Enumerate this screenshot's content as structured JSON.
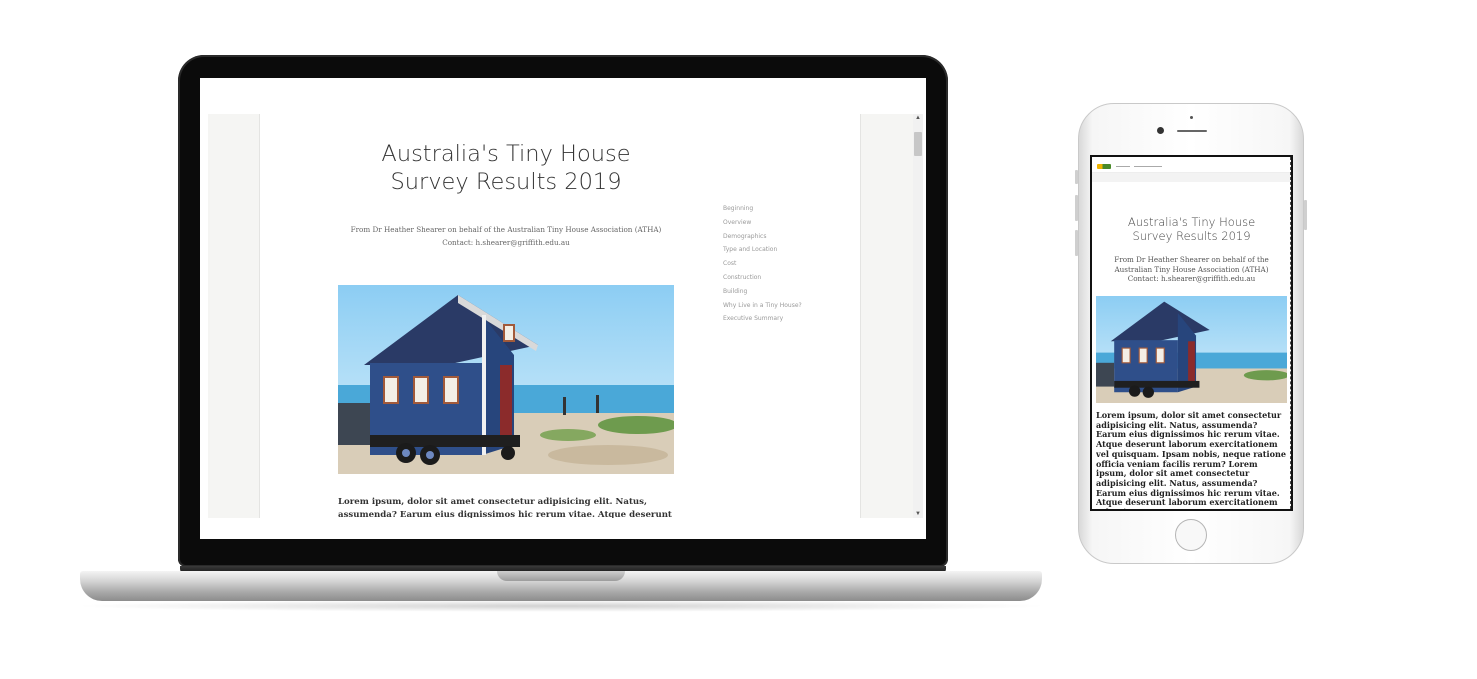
{
  "laptop_page": {
    "title": "Australia's Tiny House Survey Results 2019",
    "byline_line1": "From Dr Heather Shearer on behalf of the Australian Tiny House Association (ATHA)",
    "byline_line2": "Contact: h.shearer@griffith.edu.au",
    "toc": [
      "Beginning",
      "Overview",
      "Demographics",
      "Type and Location",
      "Cost",
      "Construction",
      "Building",
      "Why Live in a Tiny House?",
      "Executive Summary"
    ],
    "lorem": "Lorem ipsum, dolor sit amet consectetur adipisicing elit. Natus, assumenda? Earum eius dignissimos hic rerum vitae. Atque deserunt laborum"
  },
  "phone_page": {
    "title": "Australia's Tiny House Survey Results 2019",
    "byline": "From Dr Heather Shearer on behalf of the Australian Tiny House Association (ATHA) Contact: h.shearer@griffith.edu.au",
    "lorem": "Lorem ipsum, dolor sit amet consectetur adipisicing elit. Natus, assumenda? Earum eius dignissimos hic rerum vitae. Atque deserunt laborum exercitationem vel quisquam. Ipsam nobis, neque ratione officia veniam facilis rerum? Lorem ipsum, dolor sit amet consectetur adipisicing elit. Natus, assumenda? Earum eius dignissimos hic rerum vitae. Atque deserunt laborum exercitationem vel quisquam.",
    "nav_items": [
      "",
      ""
    ]
  },
  "icons": {
    "scroll_up": "scroll-up-arrow-icon",
    "scroll_down": "scroll-down-arrow-icon"
  },
  "colors": {
    "house_blue": "#2f4f8a",
    "sky": "#9fd3f2",
    "sea": "#4aa8d8",
    "gutter": "#f5f5f3"
  }
}
